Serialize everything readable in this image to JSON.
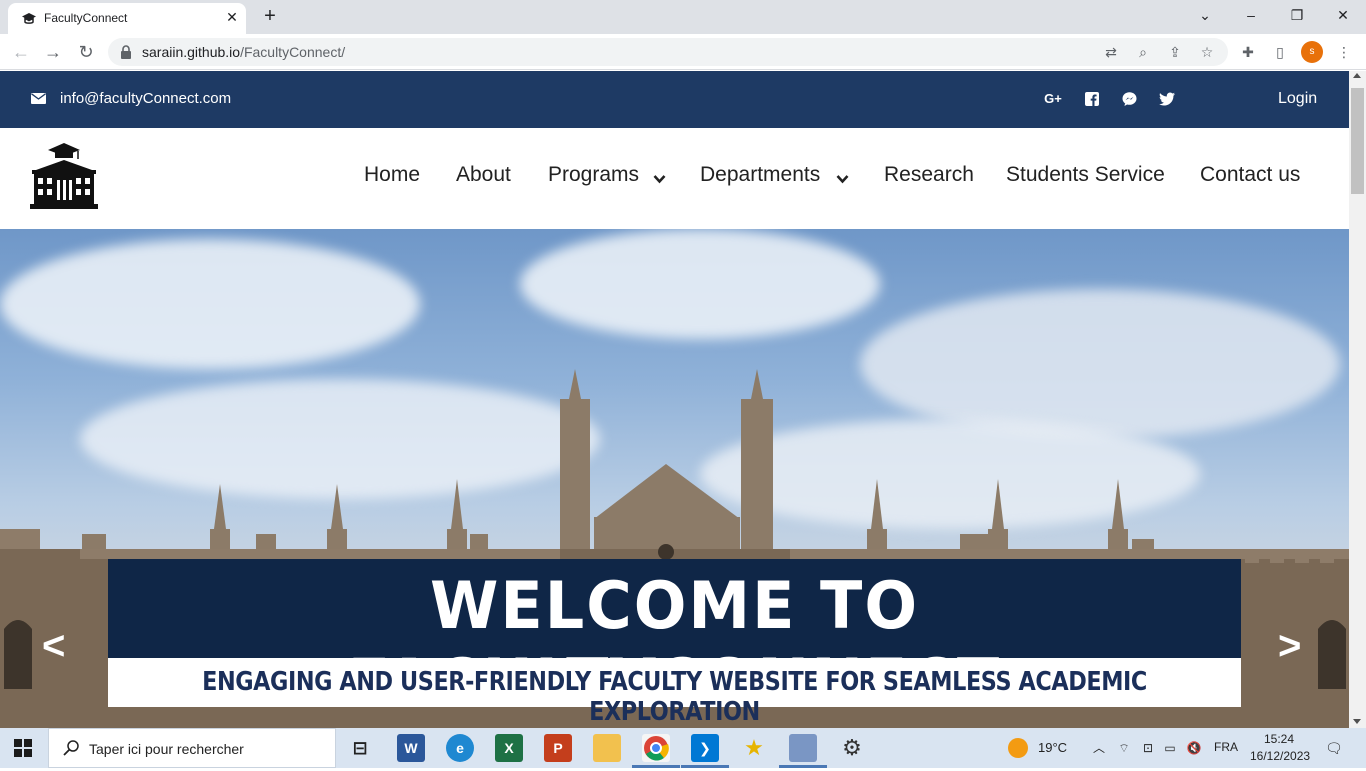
{
  "browser": {
    "tab_title": "FacultyConnect",
    "url_host": "saraiin.github.io",
    "url_path": "/FacultyConnect/",
    "profile_initial": "s"
  },
  "topbar": {
    "email": "info@facultyConnect.com",
    "social_icons": [
      "google-plus-icon",
      "facebook-icon",
      "messenger-icon",
      "twitter-icon"
    ],
    "login_label": "Login"
  },
  "nav": {
    "home": "Home",
    "about": "About",
    "programs": "Programs",
    "departments": "Departments",
    "research": "Research",
    "students_service": "Students Service",
    "contact": "Contact us"
  },
  "hero": {
    "title": "WELCOME TO FACULTYCONNECT",
    "subtitle": "ENGAGING AND USER-FRIENDLY FACULTY WEBSITE FOR SEAMLESS ACADEMIC EXPLORATION",
    "prev_arrow": "<",
    "next_arrow": ">"
  },
  "taskbar": {
    "search_placeholder": "Taper ici pour rechercher",
    "weather": "19°C",
    "language": "FRA",
    "time": "15:24",
    "date": "16/12/2023"
  },
  "colors": {
    "topbar_bg": "#1e3a64",
    "banner_bg": "#0f2647",
    "subtitle_text": "#1b2f5a"
  }
}
